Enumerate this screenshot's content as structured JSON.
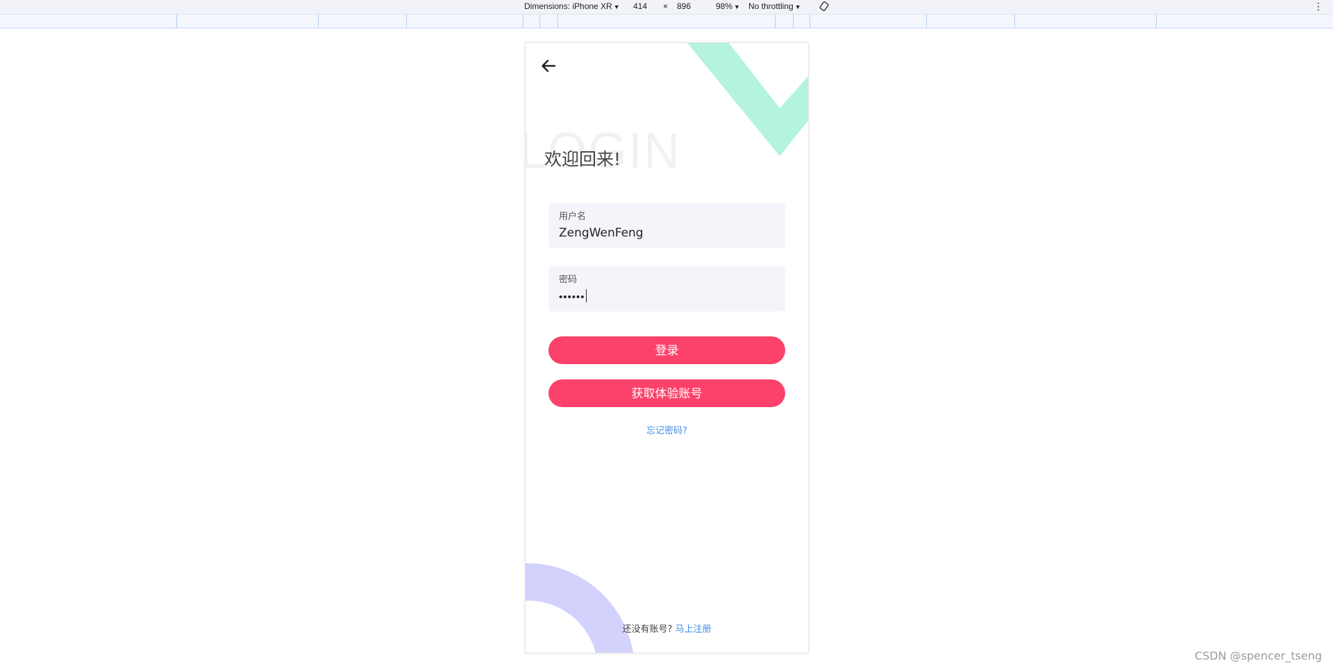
{
  "devtools": {
    "dimensions_label": "Dimensions: iPhone XR",
    "width": "414",
    "times": "×",
    "height": "896",
    "zoom": "98%",
    "throttling": "No throttling",
    "rotate_icon": "rotate-icon",
    "menu_icon": "⋮"
  },
  "page": {
    "back_icon": "arrow-left-icon",
    "watermark": "LOGIN",
    "welcome": "欢迎回来!",
    "username": {
      "label": "用户名",
      "value": "ZengWenFeng"
    },
    "password": {
      "label": "密码",
      "masked_value": "••••••"
    },
    "login_button": "登录",
    "trial_button": "获取体验账号",
    "forgot_link": "忘记密码?",
    "no_account_text": "还没有账号?",
    "signup_link": "马上注册",
    "colors": {
      "primary": "#fc416a",
      "link": "#3b8ee8",
      "deco_green": "#b3f3e0",
      "deco_purple": "#d3d2fd",
      "field_bg": "#f6f3fb"
    }
  },
  "watermark_credit": "CSDN @spencer_tseng"
}
